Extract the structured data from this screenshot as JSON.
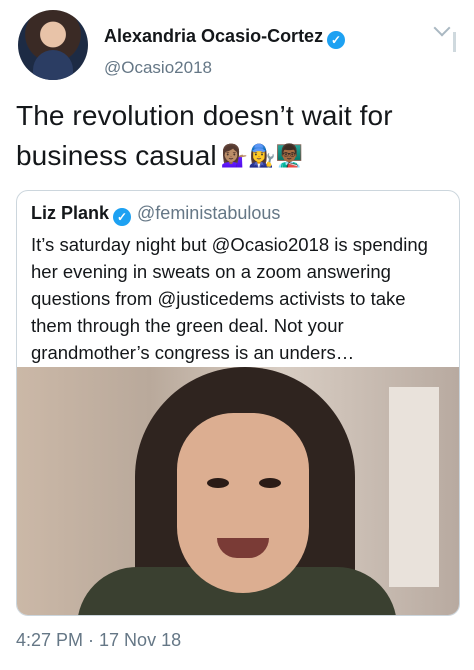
{
  "tweet": {
    "author_name": "Alexandria Ocasio-Cortez",
    "author_handle": "@Ocasio2018",
    "text": "The revolution doesn’t wait for business casual",
    "emojis": "💁🏽‍♀️👩‍🔧👨🏾‍🏫",
    "timestamp": "4:27 PM · 17 Nov 18"
  },
  "quoted_tweet": {
    "author_name": "Liz Plank",
    "author_handle": "@feministabulous",
    "text": "It’s saturday night but @Ocasio2018 is spending her evening in sweats on a zoom answering questions from @justicedems activists to take them through the green deal. Not your grandmother’s congress is an unders…"
  },
  "colors": {
    "verified": "#1da1f2",
    "secondary_text": "#657786",
    "border": "#ccd6dd"
  },
  "icons": {
    "verified": "verified-badge-icon",
    "menu": "chevron-down-icon"
  }
}
